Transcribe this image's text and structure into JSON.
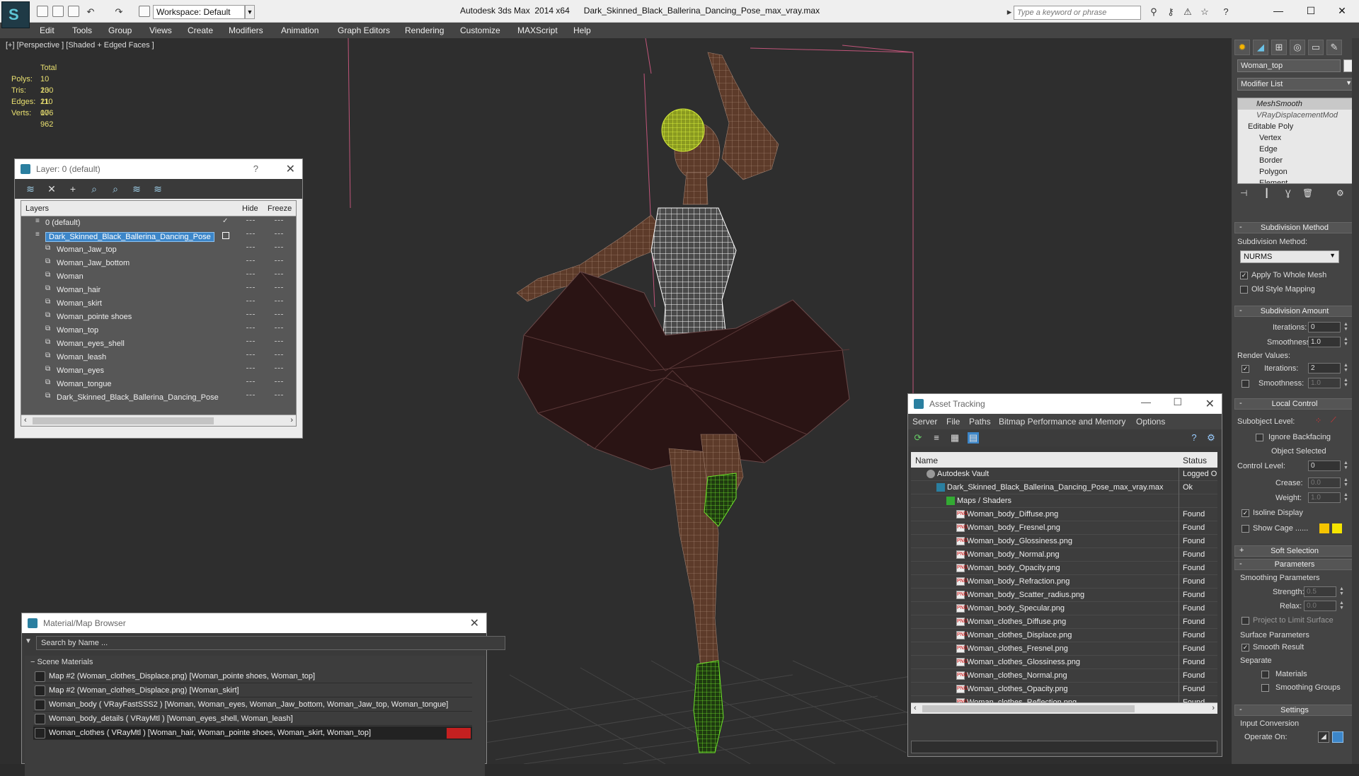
{
  "app": {
    "title": "Autodesk 3ds Max  2014 x64",
    "file": "Dark_Skinned_Black_Ballerina_Dancing_Pose_max_vray.max",
    "workspace": "Workspace: Default",
    "search_placeholder": "Type a keyword or phrase"
  },
  "menu": [
    "Edit",
    "Tools",
    "Group",
    "Views",
    "Create",
    "Modifiers",
    "Animation",
    "Graph Editors",
    "Rendering",
    "Customize",
    "MAXScript",
    "Help"
  ],
  "viewport": {
    "label": "[+] [Perspective ] [Shaded + Edged Faces ]",
    "stats": {
      "header": "Total",
      "rows": [
        {
          "k": "Polys:",
          "v": "10 130"
        },
        {
          "k": "Tris:",
          "v": "20 110"
        },
        {
          "k": "Edges:",
          "v": "21 076"
        },
        {
          "k": "Verts:",
          "v": "10 962"
        }
      ]
    }
  },
  "layer_panel": {
    "title": "Layer: 0 (default)",
    "help": "?",
    "columns": {
      "name": "Layers",
      "hide": "Hide",
      "freeze": "Freeze"
    },
    "rows": [
      {
        "name": "0 (default)",
        "level": 0
      },
      {
        "name": "Dark_Skinned_Black_Ballerina_Dancing_Pose",
        "level": 0,
        "selected": true
      },
      {
        "name": "Woman_Jaw_top",
        "level": 1
      },
      {
        "name": "Woman_Jaw_bottom",
        "level": 1
      },
      {
        "name": "Woman",
        "level": 1
      },
      {
        "name": "Woman_hair",
        "level": 1
      },
      {
        "name": "Woman_skirt",
        "level": 1
      },
      {
        "name": "Woman_pointe shoes",
        "level": 1
      },
      {
        "name": "Woman_top",
        "level": 1
      },
      {
        "name": "Woman_eyes_shell",
        "level": 1
      },
      {
        "name": "Woman_leash",
        "level": 1
      },
      {
        "name": "Woman_eyes",
        "level": 1
      },
      {
        "name": "Woman_tongue",
        "level": 1
      },
      {
        "name": "Dark_Skinned_Black_Ballerina_Dancing_Pose",
        "level": 1
      }
    ]
  },
  "material_browser": {
    "title": "Material/Map Browser",
    "search_placeholder": "Search by Name ...",
    "section": "Scene Materials",
    "rows": [
      "Map #2 (Woman_clothes_Displace.png) [Woman_pointe shoes, Woman_top]",
      "Map #2 (Woman_clothes_Displace.png) [Woman_skirt]",
      "Woman_body  ( VRayFastSSS2 ) [Woman, Woman_eyes, Woman_Jaw_bottom, Woman_Jaw_top, Woman_tongue]",
      "Woman_body_details  ( VRayMtl ) [Woman_eyes_shell, Woman_leash]",
      "Woman_clothes  ( VRayMtl ) [Woman_hair, Woman_pointe shoes, Woman_skirt, Woman_top]"
    ]
  },
  "asset_tracking": {
    "title": "Asset Tracking",
    "menu": [
      "Server",
      "File",
      "Paths",
      "Bitmap Performance and Memory",
      "Options"
    ],
    "columns": {
      "name": "Name",
      "status": "Status"
    },
    "rows": [
      {
        "name": "Autodesk Vault",
        "status": "Logged Out",
        "indent": 0
      },
      {
        "name": "Dark_Skinned_Black_Ballerina_Dancing_Pose_max_vray.max",
        "status": "Ok",
        "indent": 1
      },
      {
        "name": "Maps / Shaders",
        "status": "",
        "indent": 2
      },
      {
        "name": "Woman_body_Diffuse.png",
        "status": "Found",
        "indent": 3
      },
      {
        "name": "Woman_body_Fresnel.png",
        "status": "Found",
        "indent": 3
      },
      {
        "name": "Woman_body_Glossiness.png",
        "status": "Found",
        "indent": 3
      },
      {
        "name": "Woman_body_Normal.png",
        "status": "Found",
        "indent": 3
      },
      {
        "name": "Woman_body_Opacity.png",
        "status": "Found",
        "indent": 3
      },
      {
        "name": "Woman_body_Refraction.png",
        "status": "Found",
        "indent": 3
      },
      {
        "name": "Woman_body_Scatter_radius.png",
        "status": "Found",
        "indent": 3
      },
      {
        "name": "Woman_body_Specular.png",
        "status": "Found",
        "indent": 3
      },
      {
        "name": "Woman_clothes_Diffuse.png",
        "status": "Found",
        "indent": 3
      },
      {
        "name": "Woman_clothes_Displace.png",
        "status": "Found",
        "indent": 3
      },
      {
        "name": "Woman_clothes_Fresnel.png",
        "status": "Found",
        "indent": 3
      },
      {
        "name": "Woman_clothes_Glossiness.png",
        "status": "Found",
        "indent": 3
      },
      {
        "name": "Woman_clothes_Normal.png",
        "status": "Found",
        "indent": 3
      },
      {
        "name": "Woman_clothes_Opacity.png",
        "status": "Found",
        "indent": 3
      },
      {
        "name": "Woman_clothes_Reflection.png",
        "status": "Found",
        "indent": 3
      }
    ]
  },
  "command_panel": {
    "object_name": "Woman_top",
    "modifier_list": "Modifier List",
    "stack": [
      "MeshSmooth",
      "VRayDisplacementMod",
      "Editable Poly",
      "Vertex",
      "Edge",
      "Border",
      "Polygon",
      "Element"
    ],
    "subdivision_method": {
      "header": "Subdivision Method",
      "label": "Subdivision Method:",
      "value": "NURMS",
      "apply_whole_mesh": "Apply To Whole Mesh",
      "old_style": "Old Style Mapping"
    },
    "subdivision_amount": {
      "header": "Subdivision Amount",
      "iterations_label": "Iterations:",
      "iterations": "0",
      "smoothness_label": "Smoothness:",
      "smoothness": "1.0",
      "render_values": "Render Values:",
      "r_iterations": "2",
      "r_smoothness": "1.0"
    },
    "local_control": {
      "header": "Local Control",
      "subobject": "Subobject Level:",
      "ignore_backfacing": "Ignore Backfacing",
      "object_selected": "Object Selected",
      "control_level_label": "Control Level:",
      "control_level": "0",
      "crease_label": "Crease:",
      "crease": "0.0",
      "weight_label": "Weight:",
      "weight": "1.0",
      "isoline": "Isoline Display",
      "show_cage": "Show Cage ......"
    },
    "soft_selection": "Soft Selection",
    "parameters": {
      "header": "Parameters",
      "smoothing": "Smoothing Parameters",
      "strength_label": "Strength:",
      "strength": "0.5",
      "relax_label": "Relax:",
      "relax": "0.0",
      "project": "Project to Limit Surface",
      "surface": "Surface Parameters",
      "smooth_result": "Smooth Result",
      "separate": "Separate",
      "materials": "Materials",
      "smoothing_groups": "Smoothing Groups"
    },
    "settings": {
      "header": "Settings",
      "input_conversion": "Input Conversion",
      "operate_on": "Operate On:"
    }
  }
}
